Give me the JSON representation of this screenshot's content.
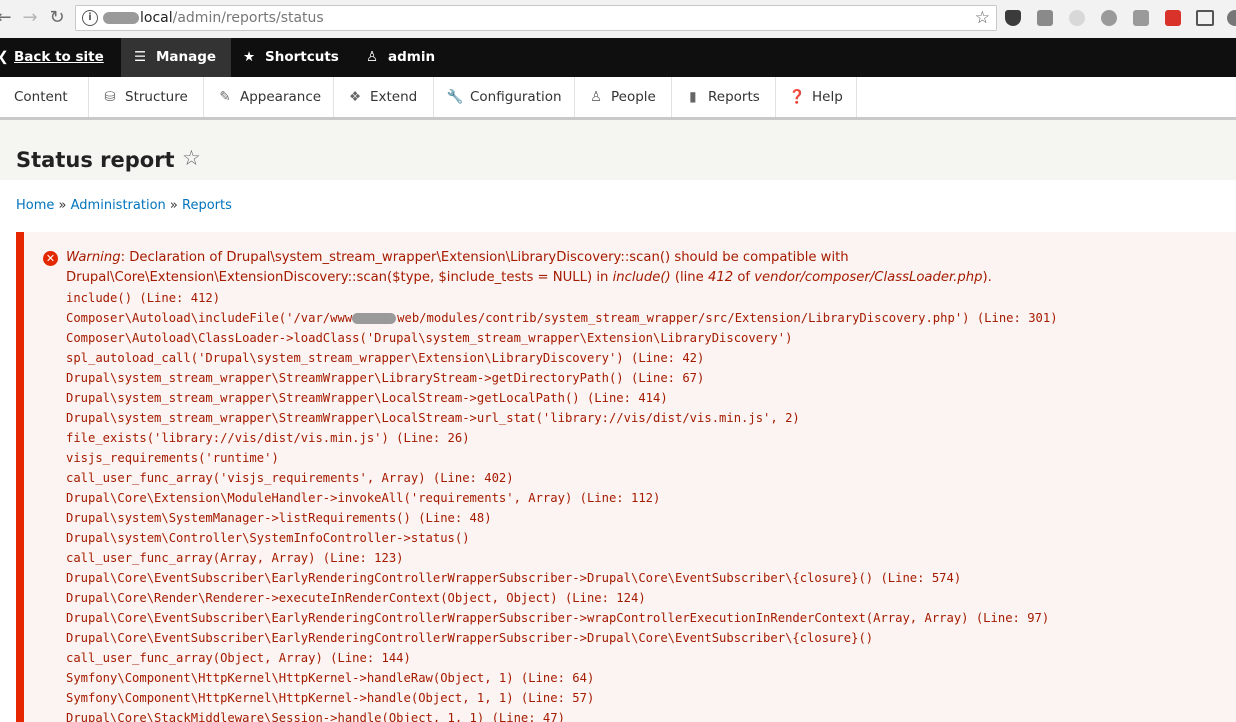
{
  "browser": {
    "url_host_suffix": "local",
    "url_path": "/admin/reports/status"
  },
  "toolbar": {
    "back": "Back to site",
    "manage": "Manage",
    "shortcuts": "Shortcuts",
    "user": "admin"
  },
  "tray": {
    "content": "Content",
    "structure": "Structure",
    "appearance": "Appearance",
    "extend": "Extend",
    "configuration": "Configuration",
    "people": "People",
    "reports": "Reports",
    "help": "Help"
  },
  "page": {
    "title": "Status report"
  },
  "breadcrumb": {
    "home": "Home",
    "sep": "»",
    "administration": "Administration",
    "reports": "Reports"
  },
  "error": {
    "label": "Warning",
    "message_1": ": Declaration of Drupal\\system_stream_wrapper\\Extension\\LibraryDiscovery::scan() should be compatible with Drupal\\Core\\Extension\\ExtensionDiscovery::scan($type, $include_tests = NULL) in ",
    "func": "include()",
    "line_pre": " (line ",
    "line": "412",
    "of": " of ",
    "file": "vendor/composer/ClassLoader.php",
    "end": ").",
    "trace_1": "include() (Line: 412)",
    "trace_2a": "Composer\\Autoload\\includeFile('/var/www",
    "trace_2b": "web/modules/contrib/system_stream_wrapper/src/Extension/LibraryDiscovery.php') (Line: 301)",
    "trace": [
      "Composer\\Autoload\\ClassLoader->loadClass('Drupal\\system_stream_wrapper\\Extension\\LibraryDiscovery')",
      "spl_autoload_call('Drupal\\system_stream_wrapper\\Extension\\LibraryDiscovery') (Line: 42)",
      "Drupal\\system_stream_wrapper\\StreamWrapper\\LibraryStream->getDirectoryPath() (Line: 67)",
      "Drupal\\system_stream_wrapper\\StreamWrapper\\LocalStream->getLocalPath() (Line: 414)",
      "Drupal\\system_stream_wrapper\\StreamWrapper\\LocalStream->url_stat('library://vis/dist/vis.min.js', 2)",
      "file_exists('library://vis/dist/vis.min.js') (Line: 26)",
      "visjs_requirements('runtime')",
      "call_user_func_array('visjs_requirements', Array) (Line: 402)",
      "Drupal\\Core\\Extension\\ModuleHandler->invokeAll('requirements', Array) (Line: 112)",
      "Drupal\\system\\SystemManager->listRequirements() (Line: 48)",
      "Drupal\\system\\Controller\\SystemInfoController->status()",
      "call_user_func_array(Array, Array) (Line: 123)",
      "Drupal\\Core\\EventSubscriber\\EarlyRenderingControllerWrapperSubscriber->Drupal\\Core\\EventSubscriber\\{closure}() (Line: 574)",
      "Drupal\\Core\\Render\\Renderer->executeInRenderContext(Object, Object) (Line: 124)",
      "Drupal\\Core\\EventSubscriber\\EarlyRenderingControllerWrapperSubscriber->wrapControllerExecutionInRenderContext(Array, Array) (Line: 97)",
      "Drupal\\Core\\EventSubscriber\\EarlyRenderingControllerWrapperSubscriber->Drupal\\Core\\EventSubscriber\\{closure}()",
      "call_user_func_array(Object, Array) (Line: 144)",
      "Symfony\\Component\\HttpKernel\\HttpKernel->handleRaw(Object, 1) (Line: 64)",
      "Symfony\\Component\\HttpKernel\\HttpKernel->handle(Object, 1, 1) (Line: 57)",
      "Drupal\\Core\\StackMiddleware\\Session->handle(Object, 1, 1) (Line: 47)"
    ]
  }
}
